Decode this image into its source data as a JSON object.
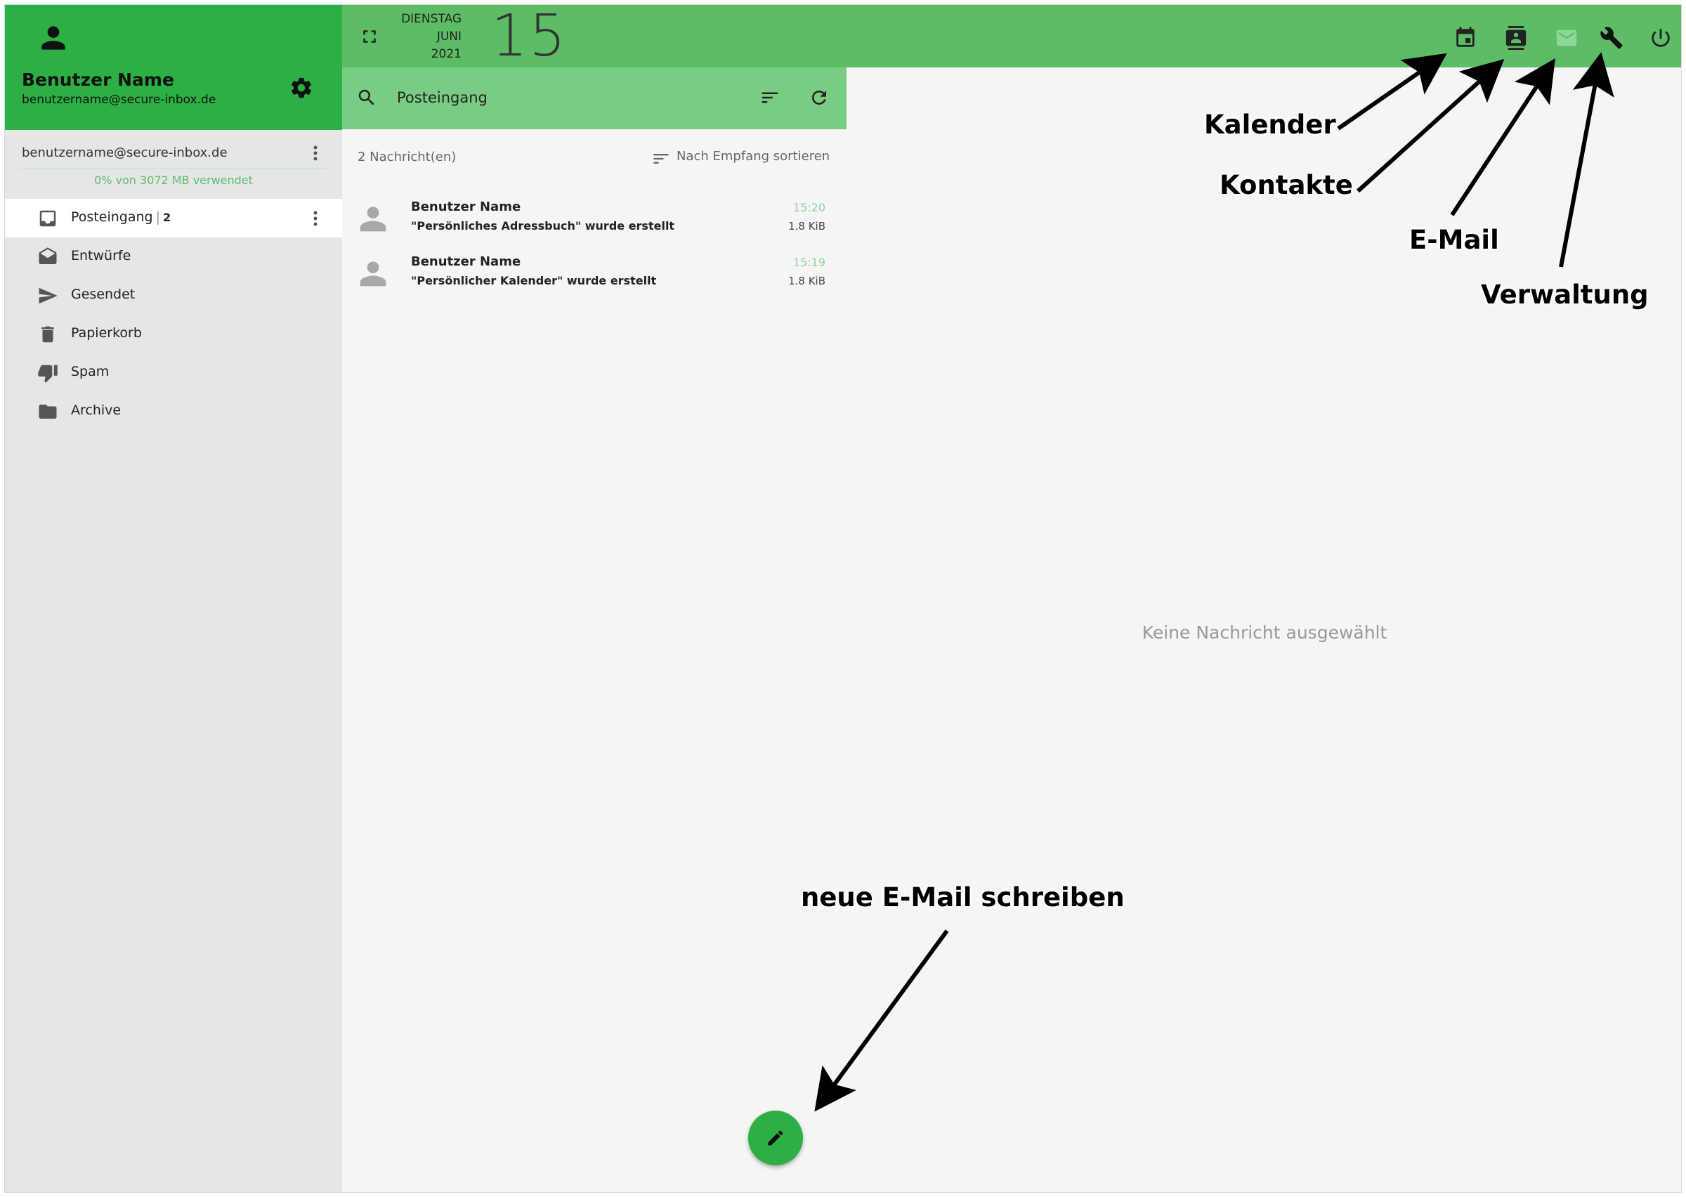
{
  "user": {
    "name": "Benutzer Name",
    "email": "benutzername@secure-inbox.de"
  },
  "account": {
    "email": "benutzername@secure-inbox.de",
    "quota": "0% von 3072 MB verwendet"
  },
  "folders": [
    {
      "label": "Posteingang",
      "count": "2",
      "icon": "inbox-icon",
      "active": true
    },
    {
      "label": "Entwürfe",
      "icon": "drafts-icon"
    },
    {
      "label": "Gesendet",
      "icon": "send-icon"
    },
    {
      "label": "Papierkorb",
      "icon": "trash-icon"
    },
    {
      "label": "Spam",
      "icon": "thumb-down-icon"
    },
    {
      "label": "Archive",
      "icon": "folder-icon"
    }
  ],
  "date": {
    "weekday": "DIENSTAG",
    "month": "JUNI",
    "year": "2021",
    "day": "15"
  },
  "search": {
    "folder": "Posteingang"
  },
  "list": {
    "count": "2 Nachricht(en)",
    "sort_label": "Nach Empfang sortieren",
    "messages": [
      {
        "sender": "Benutzer Name",
        "subject": "\"Persönliches Adressbuch\" wurde erstellt",
        "time": "15:20",
        "size": "1.8 KiB"
      },
      {
        "sender": "Benutzer Name",
        "subject": "\"Persönlicher Kalender\" wurde erstellt",
        "time": "15:19",
        "size": "1.8 KiB"
      }
    ]
  },
  "reading": {
    "empty": "Keine Nachricht ausgewählt"
  },
  "annotations": {
    "calendar": "Kalender",
    "contacts": "Kontakte",
    "email": "E-Mail",
    "admin": "Verwaltung",
    "compose": "neue E-Mail schreiben"
  },
  "colors": {
    "primary": "#2db043",
    "topbar": "#5dbd66",
    "searchbar": "#7acc82",
    "sidebar": "#e6e6e6",
    "pane": "#f5f5f5"
  }
}
